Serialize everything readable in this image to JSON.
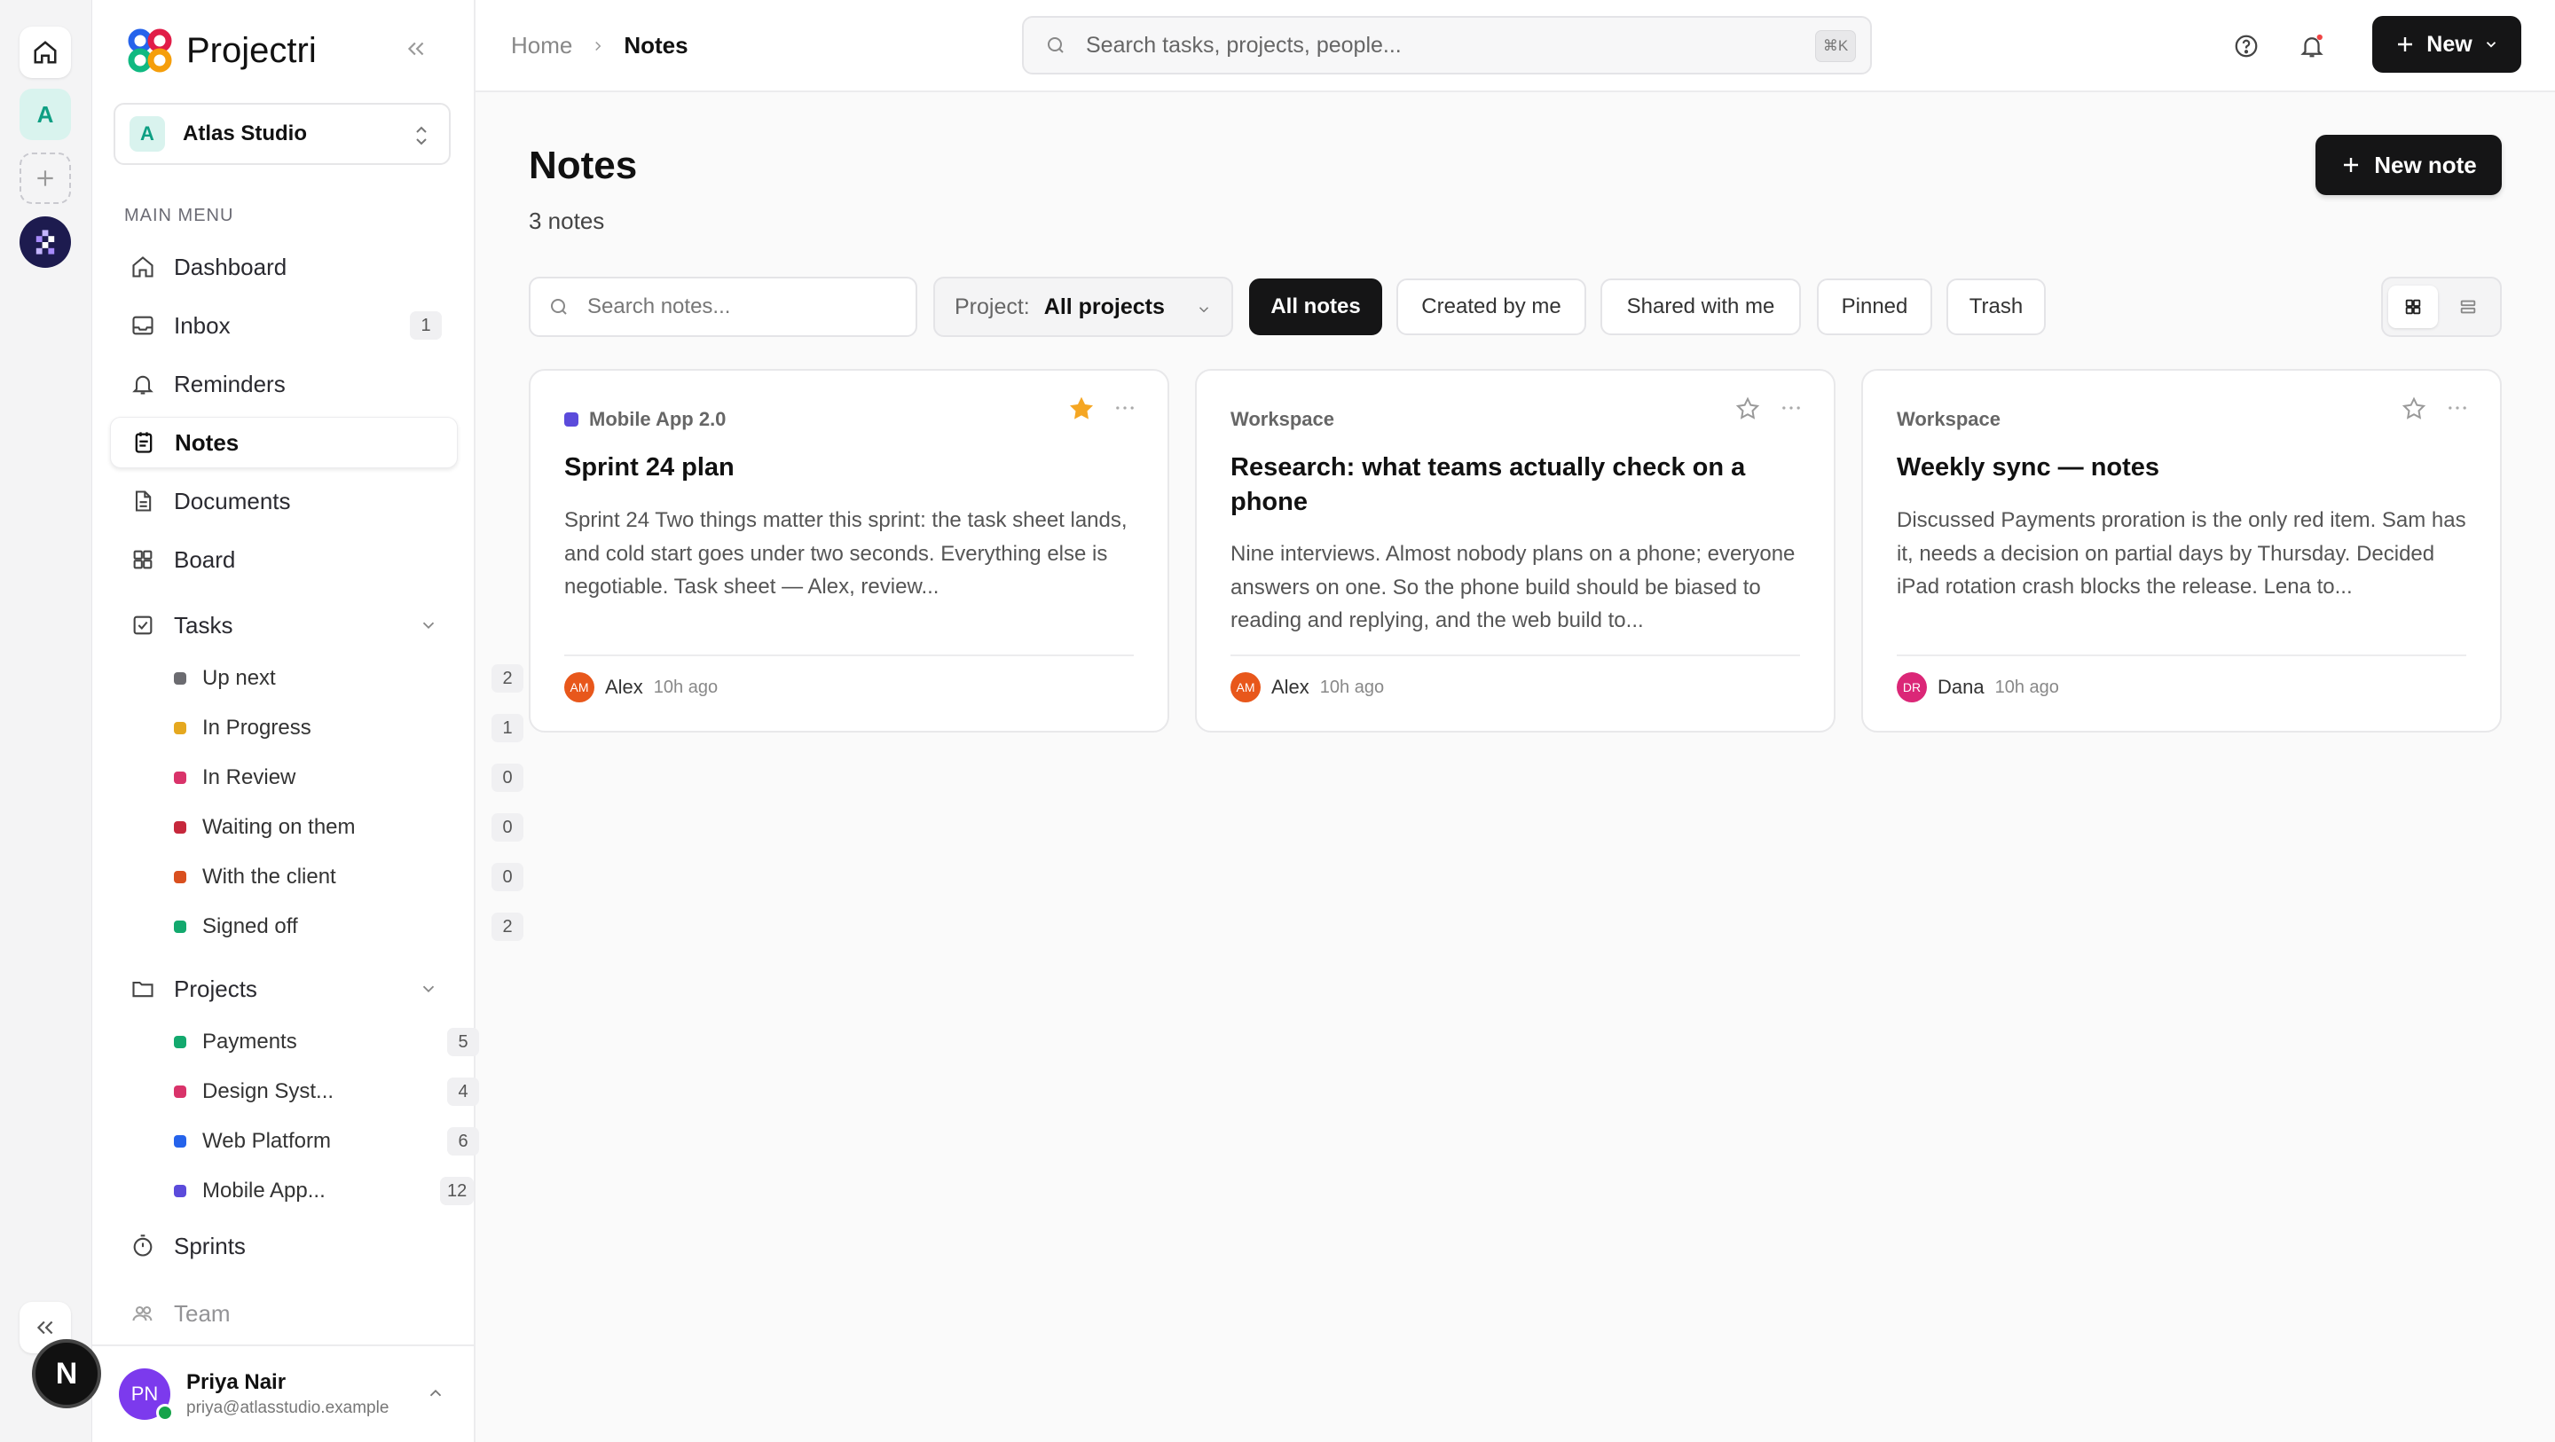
{
  "app": {
    "name": "Projectri"
  },
  "rail": {
    "workspace_initial": "A"
  },
  "workspace": {
    "initial": "A",
    "name": "Atlas Studio"
  },
  "sidebar": {
    "section_label": "MAIN MENU",
    "items": [
      {
        "label": "Dashboard",
        "icon": "home-icon"
      },
      {
        "label": "Inbox",
        "icon": "inbox-icon",
        "count": "1"
      },
      {
        "label": "Reminders",
        "icon": "bell-icon"
      },
      {
        "label": "Notes",
        "icon": "notes-icon",
        "active": true
      },
      {
        "label": "Documents",
        "icon": "document-icon"
      },
      {
        "label": "Board",
        "icon": "board-icon"
      },
      {
        "label": "Tasks",
        "icon": "checkbox-icon"
      },
      {
        "label": "Projects",
        "icon": "folder-icon"
      },
      {
        "label": "Sprints",
        "icon": "timer-icon"
      },
      {
        "label": "Team",
        "icon": "team-icon"
      }
    ],
    "tasks": [
      {
        "label": "Up next",
        "count": "2",
        "color": "#6b6b70"
      },
      {
        "label": "In Progress",
        "count": "1",
        "color": "#e5a81f"
      },
      {
        "label": "In Review",
        "count": "0",
        "color": "#d9336a"
      },
      {
        "label": "Waiting on them",
        "count": "0",
        "color": "#c6283c"
      },
      {
        "label": "With the client",
        "count": "0",
        "color": "#d9501f"
      },
      {
        "label": "Signed off",
        "count": "2",
        "color": "#13a96e"
      }
    ],
    "projects": [
      {
        "label": "Payments",
        "count": "5",
        "color": "#13a96e"
      },
      {
        "label": "Design Syst...",
        "count": "4",
        "color": "#d9336a"
      },
      {
        "label": "Web Platform",
        "count": "6",
        "color": "#2563eb"
      },
      {
        "label": "Mobile App...",
        "count": "12",
        "color": "#5b4bdb"
      }
    ]
  },
  "user": {
    "initials": "PN",
    "name": "Priya Nair",
    "email": "priya@atlasstudio.example"
  },
  "fab": {
    "label": "N"
  },
  "topbar": {
    "breadcrumb": [
      "Home",
      "Notes"
    ],
    "search_placeholder": "Search tasks, projects, people...",
    "shortcut": "⌘K",
    "new_label": "New"
  },
  "page": {
    "title": "Notes",
    "count": "3 notes",
    "new_note_label": "New note",
    "search_placeholder": "Search notes...",
    "project_filter_label": "Project:",
    "project_filter_value": "All projects",
    "filters": [
      "All notes",
      "Created by me",
      "Shared with me",
      "Pinned",
      "Trash"
    ],
    "active_filter": "All notes",
    "view_mode": "grid"
  },
  "notes": [
    {
      "project": "Mobile App 2.0",
      "project_color": "#5b4bdb",
      "pinned": true,
      "title": "Sprint 24 plan",
      "body": "Sprint 24 Two things matter this sprint: the task sheet lands, and cold start goes under two seconds. Everything else is negotiable. Task sheet — Alex, review...",
      "author": "Alex",
      "author_initials": "AM",
      "author_color": "#e8571b",
      "time": "10h ago"
    },
    {
      "project": "Workspace",
      "project_color": "",
      "pinned": false,
      "title": "Research: what teams actually check on a phone",
      "body": "Nine interviews. Almost nobody plans on a phone; everyone answers on one. So the phone build should be biased to reading and replying, and the web build to...",
      "author": "Alex",
      "author_initials": "AM",
      "author_color": "#e8571b",
      "time": "10h ago"
    },
    {
      "project": "Workspace",
      "project_color": "",
      "pinned": false,
      "title": "Weekly sync — notes",
      "body": "Discussed Payments proration is the only red item. Sam has it, needs a decision on partial days by Thursday. Decided iPad rotation crash blocks the release. Lena to...",
      "author": "Dana",
      "author_initials": "DR",
      "author_color": "#db2777",
      "time": "10h ago"
    }
  ]
}
